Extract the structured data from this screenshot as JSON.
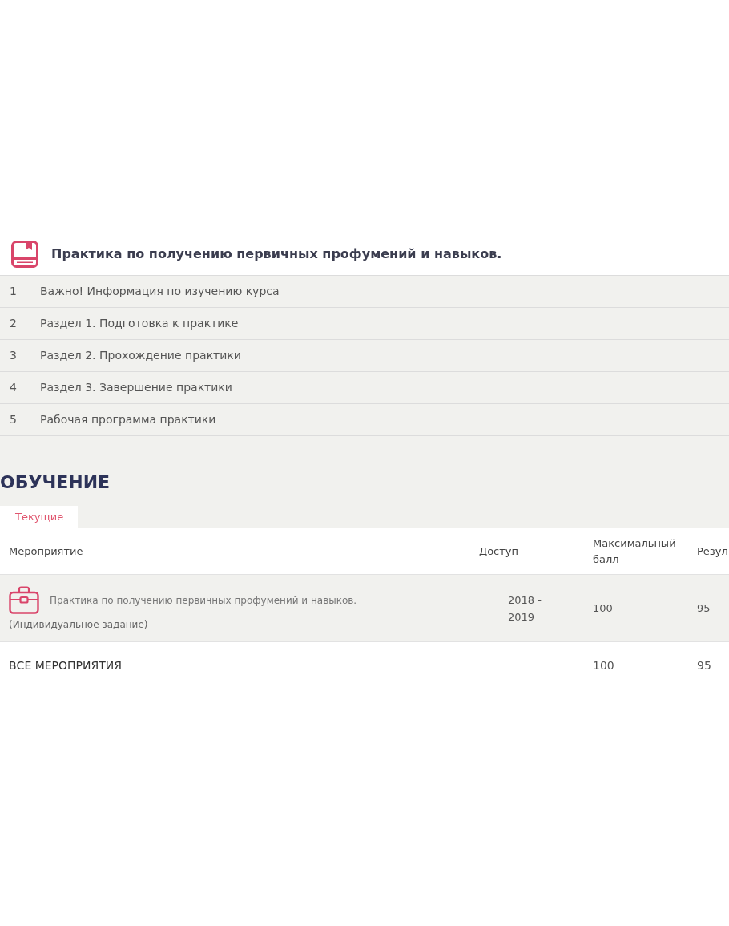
{
  "course": {
    "title": "Практика по получению первичных профумений и навыков.",
    "modules": [
      {
        "number": "1",
        "title": "Важно! Информация по изучению курса"
      },
      {
        "number": "2",
        "title": "Раздел 1. Подготовка к практике"
      },
      {
        "number": "3",
        "title": "Раздел 2. Прохождение практики"
      },
      {
        "number": "4",
        "title": "Раздел 3. Завершение практики"
      },
      {
        "number": "5",
        "title": "Рабочая программа практики"
      }
    ]
  },
  "section": {
    "title": "ОБУЧЕНИЕ"
  },
  "tabs": [
    {
      "label": "Текущие",
      "selected": true
    }
  ],
  "table": {
    "columns": [
      "Мероприятие",
      "Доступ",
      "Максимальный балл",
      "Резул"
    ],
    "rows": [
      {
        "title": "Практика по получению первичных профумений и навыков.",
        "subtitle": "(Индивидуальное задание)",
        "access": "2018 - 2019",
        "max_score": "100",
        "result": "95"
      }
    ],
    "total": {
      "label": "ВСЕ МЕРОПРИЯТИЯ",
      "max_score": "100",
      "result": "95"
    }
  }
}
